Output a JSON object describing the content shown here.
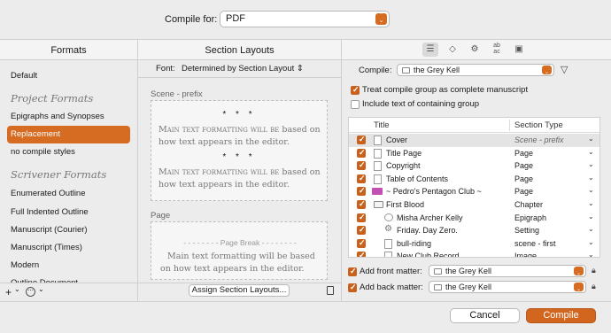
{
  "header": {
    "compile_for_label": "Compile for:",
    "format_value": "PDF"
  },
  "columns": {
    "formats": "Formats",
    "section_layouts": "Section Layouts"
  },
  "sidebar": {
    "items": [
      {
        "type": "item",
        "label": "Default"
      },
      {
        "type": "group",
        "label": "Project Formats"
      },
      {
        "type": "item",
        "label": "Epigraphs and Synopses"
      },
      {
        "type": "item",
        "label": "Replacement",
        "selected": true
      },
      {
        "type": "item",
        "label": "no compile styles"
      },
      {
        "type": "group",
        "label": "Scrivener Formats"
      },
      {
        "type": "item",
        "label": "Enumerated Outline"
      },
      {
        "type": "item",
        "label": "Full Indented Outline"
      },
      {
        "type": "item",
        "label": "Manuscript (Courier)"
      },
      {
        "type": "item",
        "label": "Manuscript (Times)"
      },
      {
        "type": "item",
        "label": "Modern"
      },
      {
        "type": "item",
        "label": "Outline Document"
      }
    ],
    "footer": {
      "add": "+",
      "add_chevron": "⌄",
      "more": "⋯",
      "more_chevron": "⌄"
    }
  },
  "middle": {
    "font_label": "Font:",
    "font_value": "Determined by Section Layout",
    "layouts": [
      {
        "name": "Scene - prefix",
        "stars": "* * *",
        "text_smallcaps": "Main text formatting will be",
        "text_rest": " based on how text appears in the editor."
      },
      {
        "name": "Page",
        "page_break": "Page Break",
        "text": "Main text formatting will be based on how text appears in the editor."
      }
    ],
    "assign_button": "Assign Section Layouts..."
  },
  "right": {
    "toolbar_icons": [
      "list-icon",
      "tag-icon",
      "gear-icon",
      "spelling-icon",
      "image-icon"
    ],
    "compile_label": "Compile:",
    "compile_value": "the Grey Kell",
    "treat_group_label": "Treat compile group as complete manuscript",
    "treat_group_checked": true,
    "include_containing_label": "Include text of containing group",
    "include_containing_checked": false,
    "table": {
      "headers": {
        "title": "Title",
        "section_type": "Section Type"
      },
      "rows": [
        {
          "title": "Cover",
          "type": "Scene - prefix",
          "indent": 0,
          "icon": "doc",
          "italic_type": true,
          "selected": true
        },
        {
          "title": "Title Page",
          "type": "Page",
          "indent": 0,
          "icon": "doc"
        },
        {
          "title": "Copyright",
          "type": "Page",
          "indent": 0,
          "icon": "doc"
        },
        {
          "title": "Table of Contents",
          "type": "Page",
          "indent": 0,
          "icon": "doc"
        },
        {
          "title": "~ Pedro's Pentagon Club ~",
          "type": "Page",
          "indent": 0,
          "icon": "pink"
        },
        {
          "title": "First Blood",
          "type": "Chapter",
          "indent": 0,
          "icon": "folder"
        },
        {
          "title": "Misha Archer Kelly",
          "type": "Epigraph",
          "indent": 1,
          "icon": "bubble"
        },
        {
          "title": "Friday. Day Zero.",
          "type": "Setting",
          "indent": 1,
          "icon": "gear"
        },
        {
          "title": "bull-riding",
          "type": "scene - first",
          "indent": 1,
          "icon": "doc"
        },
        {
          "title": "New Club Record",
          "type": "Image",
          "indent": 1,
          "icon": "doc"
        }
      ]
    },
    "front_matter_label": "Add front matter:",
    "front_matter_value": "the Grey Kell",
    "back_matter_label": "Add back matter:",
    "back_matter_value": "the Grey Kell"
  },
  "footer": {
    "cancel": "Cancel",
    "compile": "Compile"
  },
  "colors": {
    "accent": "#d66b22",
    "selected_row": "#e4e4e4"
  }
}
